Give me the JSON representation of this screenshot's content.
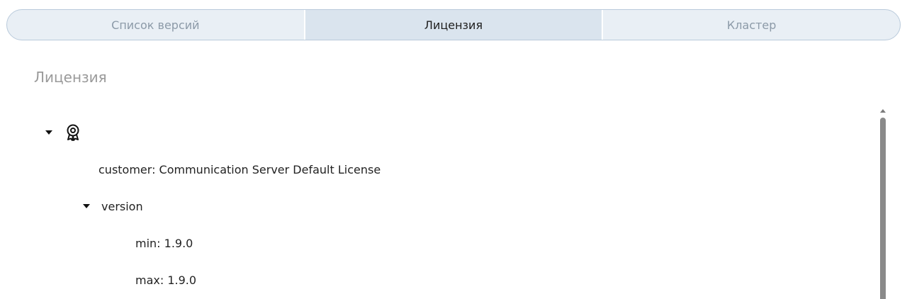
{
  "tabs": [
    {
      "label": "Список версий",
      "active": false
    },
    {
      "label": "Лицензия",
      "active": true
    },
    {
      "label": "Кластер",
      "active": false
    }
  ],
  "section": {
    "title": "Лицензия"
  },
  "tree": {
    "root_icon": "license-badge-icon",
    "customer": "customer: Communication Server Default License",
    "version_label": "version",
    "min": "min: 1.9.0",
    "max": "max: 1.9.0"
  },
  "colors": {
    "tab_active_bg": "#dae4ee",
    "tab_bg": "#e9eff5",
    "tab_border": "#b9cadb",
    "muted_text": "#8c9aa8",
    "scrollbar_thumb": "#8a8a8a"
  }
}
